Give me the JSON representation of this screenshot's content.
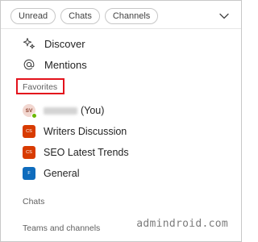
{
  "filters": [
    {
      "label": "Unread"
    },
    {
      "label": "Chats"
    },
    {
      "label": "Channels"
    }
  ],
  "icons": {
    "collapse": "chevron-down-icon",
    "discover": "sparkle-icon",
    "mentions": "at-sign-icon"
  },
  "nav": {
    "discover": "Discover",
    "mentions": "Mentions"
  },
  "favorites": {
    "title": "Favorites",
    "self": {
      "initials": "SV",
      "suffix": "(You)",
      "presence": "available"
    },
    "items": [
      {
        "label": "Writers Discussion",
        "initials": "CS",
        "color": "#d83b01"
      },
      {
        "label": "SEO Latest Trends",
        "initials": "CS",
        "color": "#d83b01"
      },
      {
        "label": "General",
        "initials": "F",
        "color": "#0f6cbd"
      }
    ]
  },
  "sections": {
    "chats": "Chats",
    "teams": "Teams and channels"
  },
  "watermark": "admindroid.com",
  "colors": {
    "highlight_box": "#e3121c",
    "presence_available": "#6bb700"
  }
}
